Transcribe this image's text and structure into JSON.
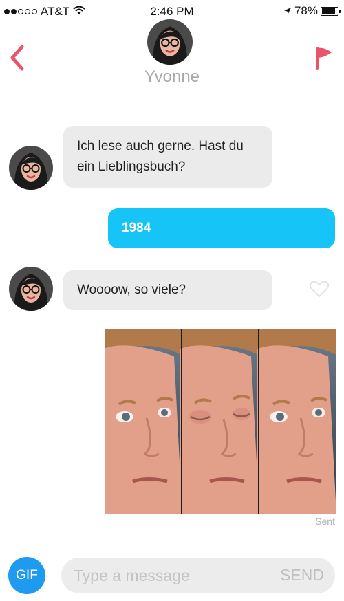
{
  "status_bar": {
    "carrier": "AT&T",
    "time": "2:46 PM",
    "battery": "78%",
    "battery_level": 0.78,
    "signal_bars": 2
  },
  "header": {
    "contact_name": "Yvonne",
    "back_icon": "chevron-left-icon",
    "flag_icon": "flag-icon"
  },
  "messages": [
    {
      "direction": "incoming",
      "text": "Ich lese auch gerne. Hast du ein Lieblingsbuch?"
    },
    {
      "direction": "outgoing",
      "text": "1984"
    },
    {
      "direction": "incoming",
      "text": "Woooow, so viele?"
    },
    {
      "direction": "outgoing",
      "type": "gif",
      "status": "Sent"
    }
  ],
  "composer": {
    "gif_label": "GIF",
    "placeholder": "Type a message",
    "send_label": "SEND"
  },
  "colors": {
    "accent_red": "#e8546a",
    "outgoing_bubble": "#16c4f7",
    "incoming_bubble": "#ebebeb",
    "gif_button": "#1e9bef"
  }
}
